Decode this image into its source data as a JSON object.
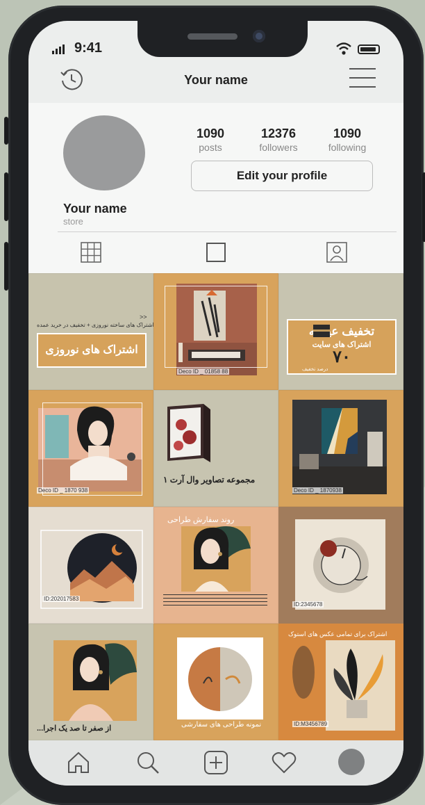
{
  "status_bar": {
    "time": "9:41"
  },
  "header": {
    "title": "Your name"
  },
  "profile": {
    "name": "Your name",
    "category": "store",
    "stats": [
      {
        "value": "1090",
        "label": "posts"
      },
      {
        "value": "12376",
        "label": "followers"
      },
      {
        "value": "1090",
        "label": "following"
      }
    ],
    "edit_button": "Edit your profile"
  },
  "tabs": [
    "grid-icon",
    "tv-icon",
    "tagged-icon"
  ],
  "posts": [
    {
      "title": "اشتراک های نوروزی",
      "subtitle": "اشتراک های ساخته نوروزی + تخفیف در خرید عمده",
      "arrows": ">>"
    },
    {
      "code": "Deco ID _ 01858 88"
    },
    {
      "title": "تخفیف عیدانه",
      "subtitle": "اشتراک های سایت",
      "number": "۷۰",
      "note": "درصد تخفیف"
    },
    {
      "code": "Deco ID _ 1870 938"
    },
    {
      "title": "مجموعه تصاویر وال آرت ۱"
    },
    {
      "code": "Deco ID _ 1870938"
    },
    {
      "code": "ID:202017583"
    },
    {
      "title": "روند سفارش طراحی"
    },
    {
      "code": "ID:2345678"
    },
    {
      "caption": "از صفر تا صد یک اجرا..."
    },
    {
      "caption": "نمونه طراحی های سفارشی"
    },
    {
      "title": "اشتراک برای تمامی عکس های استوک",
      "code": "ID:M3456789"
    }
  ],
  "bottom_nav": [
    "home-icon",
    "search-icon",
    "add-post-icon",
    "heart-icon",
    "profile-avatar"
  ],
  "colors": {
    "tan": "#d8a35c",
    "sage": "#c7c4b0",
    "peach": "#e7b48f",
    "dark": "#1f2124"
  }
}
